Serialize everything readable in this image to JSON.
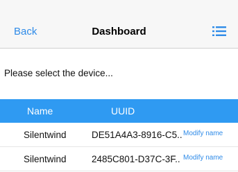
{
  "nav": {
    "back_label": "Back",
    "title": "Dashboard",
    "menu_icon": "list-icon",
    "accent": "#2f8be8"
  },
  "main": {
    "prompt": "Please select the device..."
  },
  "table": {
    "header_color": "#2f9af2",
    "columns": [
      "Name",
      "UUID"
    ],
    "rows": [
      {
        "name": "Silentwind",
        "uuid": "DE51A4A3-8916-C5..",
        "action": "Modify name"
      },
      {
        "name": "Silentwind",
        "uuid": "2485C801-D37C-3F..",
        "action": "Modify name"
      }
    ]
  }
}
